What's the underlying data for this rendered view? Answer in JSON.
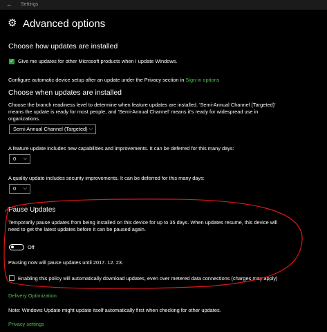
{
  "app": {
    "title": "Settings",
    "back_glyph": "←"
  },
  "page": {
    "title": "Advanced options",
    "icon": "gear-icon"
  },
  "install": {
    "heading": "Choose how updates are installed",
    "checkbox_label": "Give me updates for other Microsoft products when I update Windows.",
    "checkbox_checked": true,
    "configure_text": "Configure automatic device setup after an update under the Privacy section in",
    "signin_link": "Sign-in options"
  },
  "when": {
    "heading": "Choose when updates are installed",
    "desc_line1": "Choose the branch readiness level to determine when feature updates are installed. 'Semi-Annual Channel (Targeted)'",
    "desc_line2": "means the update is ready for most people, and 'Semi-Annual Channel' means it's ready for widespread use in",
    "desc_line3": "organizations.",
    "channel_value": "Semi-Annual Channel (Targeted)",
    "feature_label": "A feature update includes new capabilities and improvements. It can be deferred for this many days:",
    "feature_value": "0",
    "quality_label": "A quality update includes security improvements. It can be deferred for this many days:",
    "quality_value": "0"
  },
  "pause": {
    "heading": "Pause Updates",
    "desc_line1": "Temporarily pause updates from being installed on this device for up to 35 days. When updates resume, this device will",
    "desc_line2": "need to get the latest updates before it can be paused again.",
    "toggle_label": "Off",
    "toggle_on": false,
    "until_text": "Pausing now will pause updates until 2017. 12. 23."
  },
  "metered": {
    "label": "Enabling this policy will automatically download updates, even over metered data connections (charges may apply)",
    "checked": false
  },
  "links": {
    "delivery": "Delivery Optimization",
    "note": "Note: Windows Update might update itself automatically first when checking for other updates.",
    "privacy": "Privacy settings"
  },
  "colors": {
    "accent": "#4cbe4c",
    "checkbox": "#2f9c3e",
    "annotation": "#e01818"
  }
}
